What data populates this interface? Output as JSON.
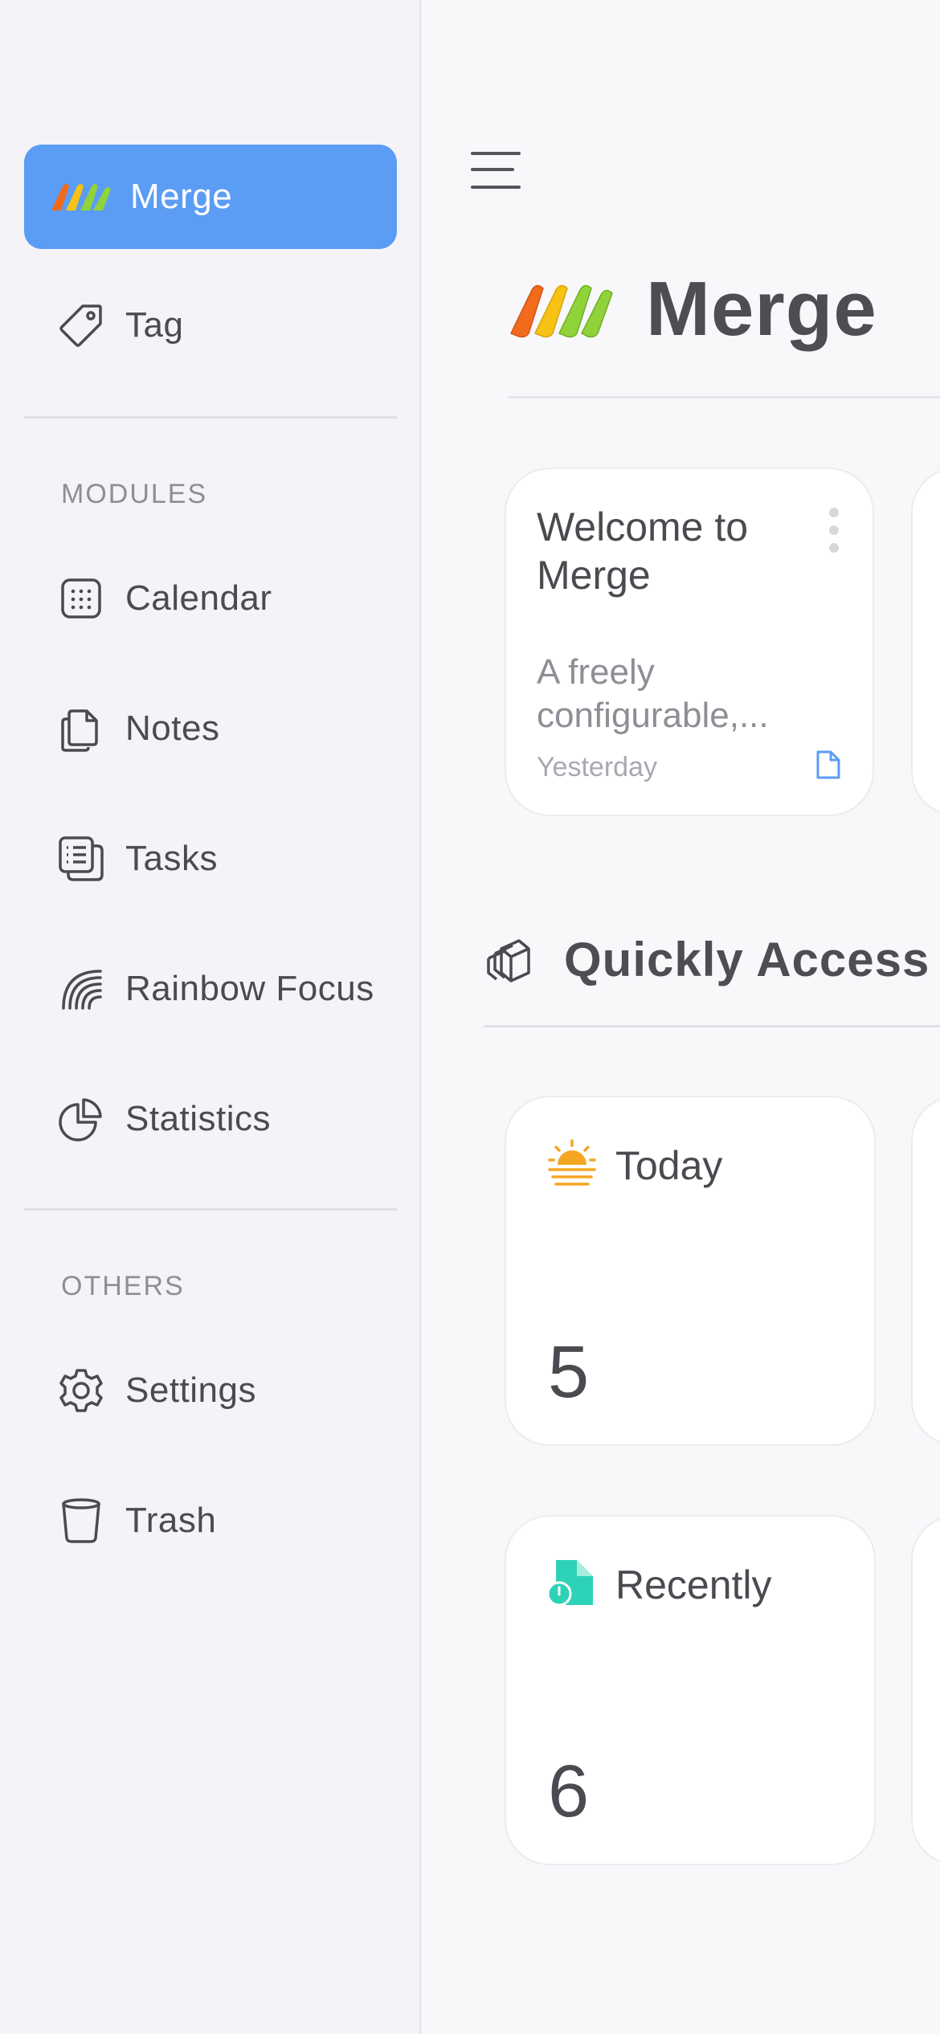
{
  "sidebar": {
    "items": [
      {
        "label": "Merge",
        "icon": "merge-logo-icon",
        "active": true
      },
      {
        "label": "Tag",
        "icon": "tag-icon"
      }
    ],
    "modules_label": "MODULES",
    "modules": [
      {
        "label": "Calendar",
        "icon": "calendar-icon"
      },
      {
        "label": "Notes",
        "icon": "notes-icon"
      },
      {
        "label": "Tasks",
        "icon": "tasks-icon"
      },
      {
        "label": "Rainbow Focus",
        "icon": "rainbow-icon"
      },
      {
        "label": "Statistics",
        "icon": "pie-chart-icon"
      }
    ],
    "others_label": "OTHERS",
    "others": [
      {
        "label": "Settings",
        "icon": "gear-icon"
      },
      {
        "label": "Trash",
        "icon": "trash-icon"
      }
    ],
    "active_color": "#5b9cf5"
  },
  "main": {
    "title": "Merge",
    "note_card": {
      "title": "Welcome to Merge",
      "body": "A freely configurable,...",
      "date": "Yesterday"
    },
    "quick_access": {
      "title": "Quickly Access",
      "items": [
        {
          "label": "Today",
          "count": "5",
          "icon": "sunrise-icon",
          "color": "#f5a623"
        },
        {
          "label": "Recently",
          "count": "6",
          "icon": "recent-file-icon",
          "color": "#2ed3b7"
        }
      ]
    }
  }
}
